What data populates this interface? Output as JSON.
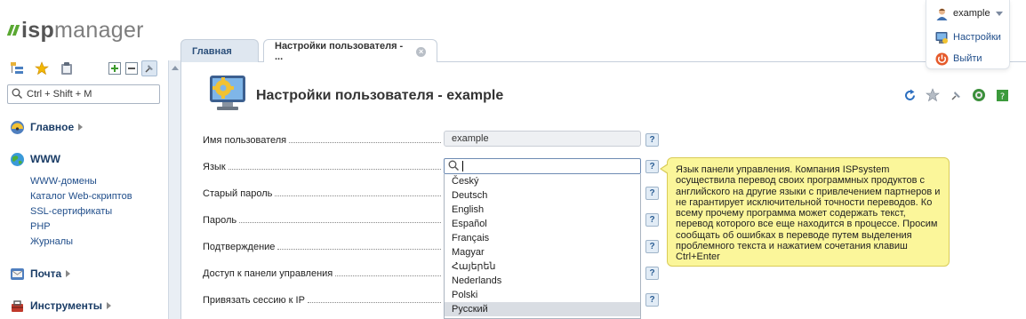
{
  "logo": {
    "prefix": "isp",
    "suffix": "manager"
  },
  "sidebar": {
    "search_placeholder": "Ctrl + Shift + M",
    "groups": [
      {
        "label": "Главное",
        "icon": "dashboard-icon",
        "items": []
      },
      {
        "label": "WWW",
        "icon": "globe-icon",
        "items": [
          "WWW-домены",
          "Каталог Web-скриптов",
          "SSL-сертификаты",
          "PHP",
          "Журналы"
        ]
      },
      {
        "label": "Почта",
        "icon": "mail-icon",
        "items": []
      },
      {
        "label": "Инструменты",
        "icon": "tools-icon",
        "items": []
      }
    ]
  },
  "tabs": [
    {
      "label": "Главная",
      "active": false
    },
    {
      "label": "Настройки пользователя - ...",
      "active": true,
      "closable": true
    }
  ],
  "page": {
    "title": "Настройки пользователя - example",
    "tool_icons": [
      "refresh-icon",
      "star-icon",
      "pin-icon",
      "globe-icon",
      "help-book-icon"
    ]
  },
  "form": {
    "fields": [
      {
        "label": "Имя пользователя",
        "value": "example"
      },
      {
        "label": "Язык",
        "value": ""
      },
      {
        "label": "Старый пароль",
        "value": ""
      },
      {
        "label": "Пароль",
        "value": ""
      },
      {
        "label": "Подтверждение",
        "value": ""
      },
      {
        "label": "Доступ к панели управления",
        "value": ""
      },
      {
        "label": "Привязать сессию к IP",
        "value": ""
      }
    ],
    "help_label": "?"
  },
  "language_dropdown": {
    "options": [
      "Český",
      "Deutsch",
      "English",
      "Español",
      "Français",
      "Magyar",
      "Հայերեն",
      "Nederlands",
      "Polski",
      "Русский"
    ],
    "highlighted": "Русский"
  },
  "tooltip": {
    "text": "Язык панели управления. Компания ISPsystem осуществила перевод своих программных продуктов с английского на другие языки с привлечением партнеров и не гарантирует исключительной точности переводов. Ко всему прочему программа может содержать текст, перевод которого все еще находится в процессе. Просим сообщать об ошибках в переводе путем выделения проблемного текста и нажатием сочетания клавиш Ctrl+Enter"
  },
  "user_menu": {
    "username": "example",
    "settings_label": "Настройки",
    "logout_label": "Выйти"
  },
  "colors": {
    "accent_green": "#5aa832",
    "link_blue": "#1f4d8a",
    "tooltip_bg": "#fbf69a"
  }
}
